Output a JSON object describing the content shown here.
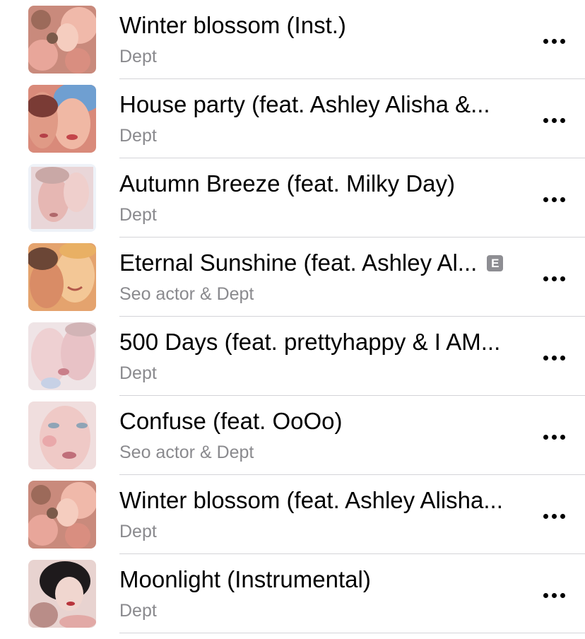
{
  "tracks": [
    {
      "title": "Winter blossom (Inst.)",
      "artist": "Dept",
      "explicit": false,
      "artwork_icon": "album-artwork-pink-flowers"
    },
    {
      "title": "House party (feat. Ashley Alisha &...",
      "artist": "Dept",
      "explicit": false,
      "artwork_icon": "album-artwork-two-faces-blue-hair"
    },
    {
      "title": "Autumn Breeze (feat. Milky Day)",
      "artist": "Dept",
      "explicit": false,
      "artwork_icon": "album-artwork-pale-faces"
    },
    {
      "title": "Eternal Sunshine (feat. Ashley Al...",
      "artist": "Seo actor & Dept",
      "explicit": true,
      "explicit_label": "E",
      "artwork_icon": "album-artwork-smiling-faces"
    },
    {
      "title": "500 Days (feat. prettyhappy & I AM...",
      "artist": "Dept",
      "explicit": false,
      "artwork_icon": "album-artwork-kissing-faces"
    },
    {
      "title": "Confuse (feat. OoOo)",
      "artist": "Seo actor & Dept",
      "explicit": false,
      "artwork_icon": "album-artwork-face-closeup"
    },
    {
      "title": "Winter blossom (feat. Ashley Alisha...",
      "artist": "Dept",
      "explicit": false,
      "artwork_icon": "album-artwork-pink-flowers"
    },
    {
      "title": "Moonlight (Instrumental)",
      "artist": "Dept",
      "explicit": false,
      "artwork_icon": "album-artwork-dark-hair-portrait"
    }
  ],
  "more_button_icon": "ellipsis-icon",
  "colors": {
    "title": "#000000",
    "artist": "#8a8a8e",
    "separator": "#d4d4d8",
    "explicit_badge": "#8e8e93"
  }
}
